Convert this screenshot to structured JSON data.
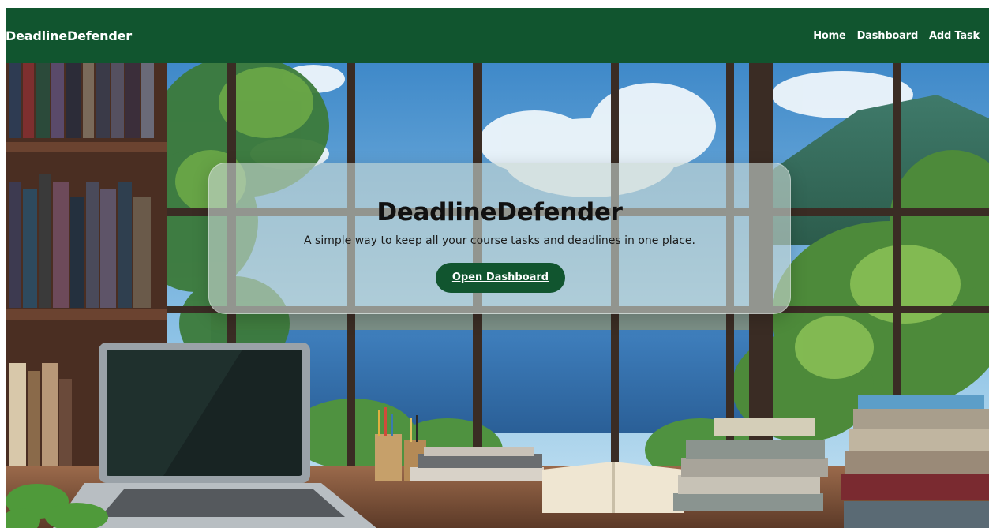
{
  "navbar": {
    "brand": "DeadlineDefender",
    "links": [
      {
        "label": "Home"
      },
      {
        "label": "Dashboard"
      },
      {
        "label": "Add Task"
      }
    ],
    "color": "#11552f"
  },
  "hero": {
    "title": "DeadlineDefender",
    "subtitle": "A simple way to keep all your course tasks and deadlines in one place.",
    "cta_label": "Open Dashboard",
    "background_image": "illustrated study room with laptop, books and window view of lake and mountains"
  },
  "colors": {
    "accent": "#11552f",
    "card_glass": "#c8d6d2"
  }
}
